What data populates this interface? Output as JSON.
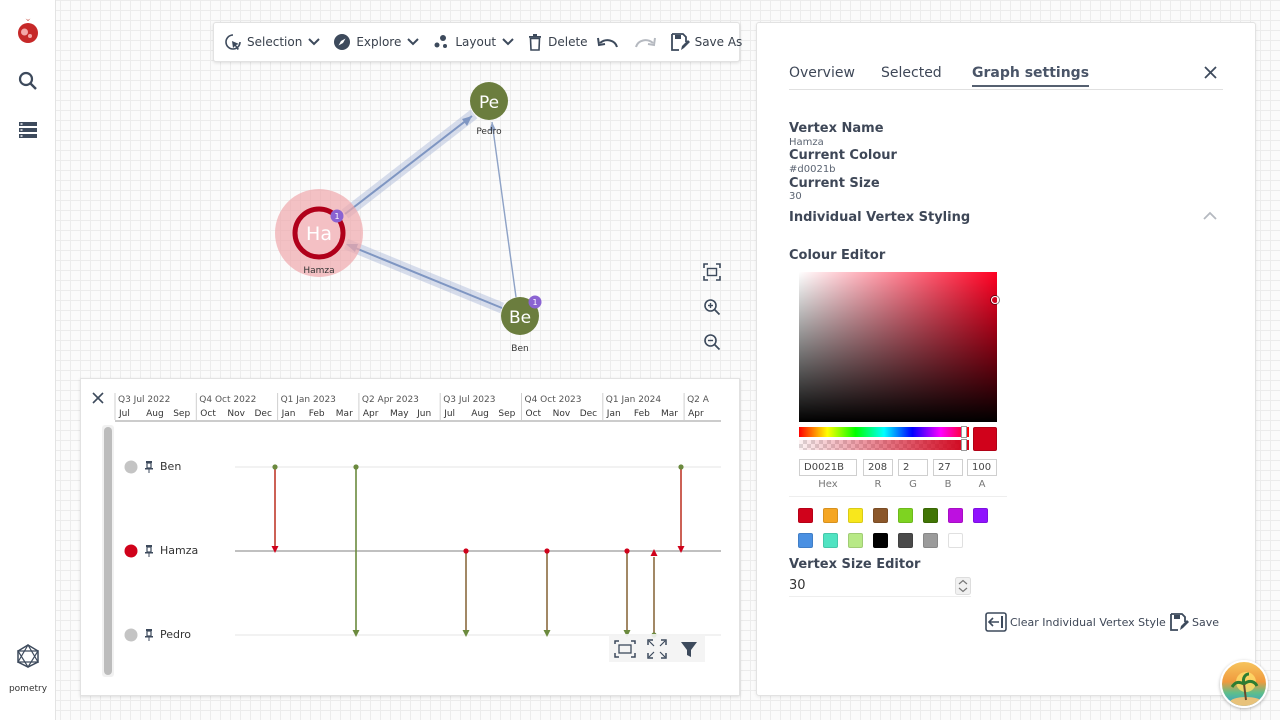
{
  "app": {
    "brand": "pometry"
  },
  "rail": {
    "items": [
      "logo-icon",
      "search-icon",
      "list-icon",
      "graph-icon"
    ]
  },
  "toolbar": {
    "selection_label": "Selection",
    "explore_label": "Explore",
    "layout_label": "Layout",
    "delete_label": "Delete",
    "save_as_label": "Save As"
  },
  "graph": {
    "nodes": [
      {
        "abbr": "Pe",
        "name": "Pedro",
        "color": "#6b7d3e"
      },
      {
        "abbr": "Ha",
        "name": "Hamza",
        "color": "#d0021b",
        "selected": true,
        "badge": "1"
      },
      {
        "abbr": "Be",
        "name": "Ben",
        "color": "#6b7d3e",
        "badge": "1"
      }
    ]
  },
  "timeline": {
    "quarters": [
      "Q3 Jul 2022",
      "Q4 Oct 2022",
      "Q1 Jan 2023",
      "Q2 Apr 2023",
      "Q3 Jul 2023",
      "Q4 Oct 2023",
      "Q1 Jan 2024",
      "Q2 A"
    ],
    "months": [
      "Jul",
      "Aug",
      "Sep",
      "Oct",
      "Nov",
      "Dec",
      "Jan",
      "Feb",
      "Mar",
      "Apr",
      "May",
      "Jun",
      "Jul",
      "Aug",
      "Sep",
      "Oct",
      "Nov",
      "Dec",
      "Jan",
      "Feb",
      "Mar",
      "Apr"
    ],
    "rows": [
      {
        "name": "Ben",
        "dot_color": "#c4c4c4"
      },
      {
        "name": "Hamza",
        "dot_color": "#d0021b"
      },
      {
        "name": "Pedro",
        "dot_color": "#c4c4c4"
      }
    ]
  },
  "panel": {
    "tabs": [
      "Overview",
      "Selected",
      "Graph settings"
    ],
    "active_tab": "Graph settings",
    "vertex_name_label": "Vertex Name",
    "vertex_name_value": "Hamza",
    "current_colour_label": "Current Colour",
    "current_colour_value": "#d0021b",
    "current_size_label": "Current Size",
    "current_size_value": "30",
    "individual_styling_label": "Individual Vertex Styling",
    "colour_editor_label": "Colour Editor",
    "colour": {
      "hex": "D0021B",
      "r": "208",
      "g": "2",
      "b": "27",
      "a": "100"
    },
    "colour_labels": {
      "hex": "Hex",
      "r": "R",
      "g": "G",
      "b": "B",
      "a": "A"
    },
    "swatches": [
      "#d0021b",
      "#f5a623",
      "#f8e71c",
      "#8b572a",
      "#7ed321",
      "#417505",
      "#bd10e0",
      "#9013fe",
      "#4a90e2",
      "#50e3c2",
      "#b8e986",
      "#000000",
      "#4a4a4a",
      "#9b9b9b",
      "#ffffff"
    ],
    "vertex_size_editor_label": "Vertex Size Editor",
    "vertex_size_value": "30",
    "clear_style_label": "Clear Individual Vertex Style",
    "save_label": "Save"
  },
  "colors": {
    "accent": "#d0021b",
    "node_green": "#6b7d3e",
    "edge_blue": "#8ea2c6",
    "badge_purple": "#8a63d2"
  }
}
